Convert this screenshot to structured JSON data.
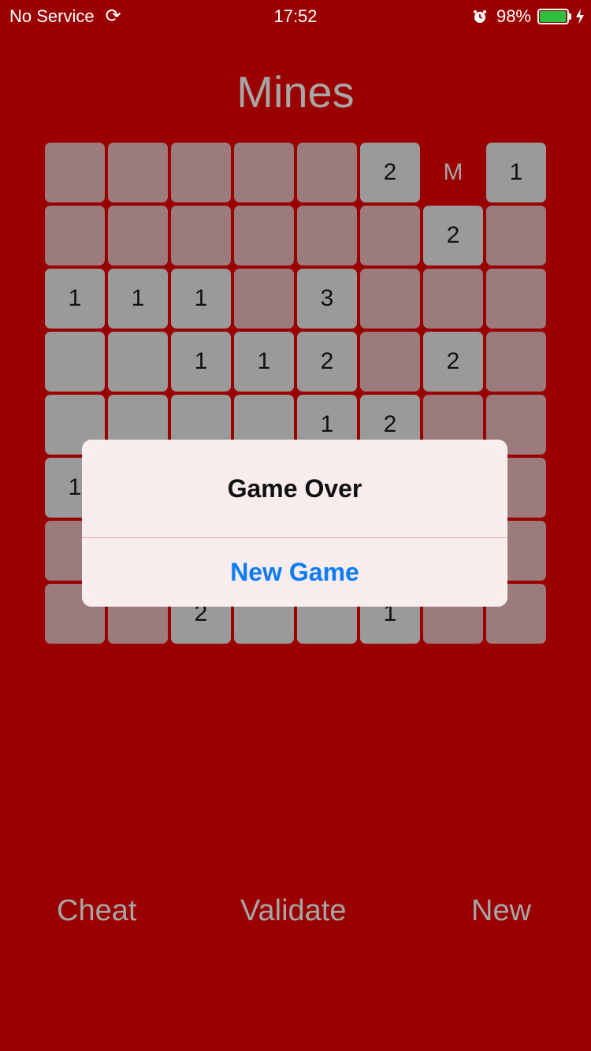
{
  "status_bar": {
    "carrier": "No Service",
    "time": "17:52",
    "battery": "98%",
    "battery_level": 0.98,
    "icons": [
      "sync-icon",
      "alarm-icon",
      "battery-icon",
      "charging-bolt-icon"
    ]
  },
  "title": "Mines",
  "board": {
    "rows": 8,
    "cols": 8,
    "cells": [
      [
        {
          "s": "h",
          "t": ""
        },
        {
          "s": "h",
          "t": ""
        },
        {
          "s": "h",
          "t": ""
        },
        {
          "s": "h",
          "t": ""
        },
        {
          "s": "h",
          "t": ""
        },
        {
          "s": "r",
          "t": "2"
        },
        {
          "s": "f",
          "t": "M"
        },
        {
          "s": "r",
          "t": "1"
        }
      ],
      [
        {
          "s": "h",
          "t": ""
        },
        {
          "s": "h",
          "t": ""
        },
        {
          "s": "h",
          "t": ""
        },
        {
          "s": "h",
          "t": ""
        },
        {
          "s": "h",
          "t": ""
        },
        {
          "s": "h",
          "t": ""
        },
        {
          "s": "r",
          "t": "2"
        },
        {
          "s": "h",
          "t": ""
        }
      ],
      [
        {
          "s": "r",
          "t": "1"
        },
        {
          "s": "r",
          "t": "1"
        },
        {
          "s": "r",
          "t": "1"
        },
        {
          "s": "h",
          "t": ""
        },
        {
          "s": "r",
          "t": "3"
        },
        {
          "s": "h",
          "t": ""
        },
        {
          "s": "h",
          "t": ""
        },
        {
          "s": "h",
          "t": ""
        }
      ],
      [
        {
          "s": "r",
          "t": ""
        },
        {
          "s": "r",
          "t": ""
        },
        {
          "s": "r",
          "t": "1"
        },
        {
          "s": "r",
          "t": "1"
        },
        {
          "s": "r",
          "t": "2"
        },
        {
          "s": "h",
          "t": ""
        },
        {
          "s": "r",
          "t": "2"
        },
        {
          "s": "h",
          "t": ""
        }
      ],
      [
        {
          "s": "r",
          "t": ""
        },
        {
          "s": "r",
          "t": ""
        },
        {
          "s": "r",
          "t": ""
        },
        {
          "s": "r",
          "t": ""
        },
        {
          "s": "r",
          "t": "1"
        },
        {
          "s": "r",
          "t": "2"
        },
        {
          "s": "h",
          "t": ""
        },
        {
          "s": "h",
          "t": ""
        }
      ],
      [
        {
          "s": "r",
          "t": "1"
        },
        {
          "s": "h",
          "t": ""
        },
        {
          "s": "h",
          "t": ""
        },
        {
          "s": "h",
          "t": ""
        },
        {
          "s": "h",
          "t": ""
        },
        {
          "s": "h",
          "t": ""
        },
        {
          "s": "h",
          "t": ""
        },
        {
          "s": "h",
          "t": ""
        }
      ],
      [
        {
          "s": "h",
          "t": ""
        },
        {
          "s": "h",
          "t": ""
        },
        {
          "s": "h",
          "t": ""
        },
        {
          "s": "h",
          "t": ""
        },
        {
          "s": "h",
          "t": ""
        },
        {
          "s": "h",
          "t": ""
        },
        {
          "s": "h",
          "t": ""
        },
        {
          "s": "h",
          "t": ""
        }
      ],
      [
        {
          "s": "h",
          "t": ""
        },
        {
          "s": "h",
          "t": ""
        },
        {
          "s": "r",
          "t": "2"
        },
        {
          "s": "r",
          "t": ""
        },
        {
          "s": "r",
          "t": ""
        },
        {
          "s": "r",
          "t": "1"
        },
        {
          "s": "h",
          "t": ""
        },
        {
          "s": "h",
          "t": ""
        }
      ]
    ]
  },
  "alert": {
    "title": "Game Over",
    "button_label": "New Game"
  },
  "toolbar": {
    "cheat_label": "Cheat",
    "validate_label": "Validate",
    "new_label": "New"
  },
  "colors": {
    "background": "#9a0000",
    "hidden_cell": "#9b7b7b",
    "revealed_cell": "#9a9a9a",
    "accent_text": "#a6a6a6",
    "alert_button": "#0a7bf0"
  }
}
